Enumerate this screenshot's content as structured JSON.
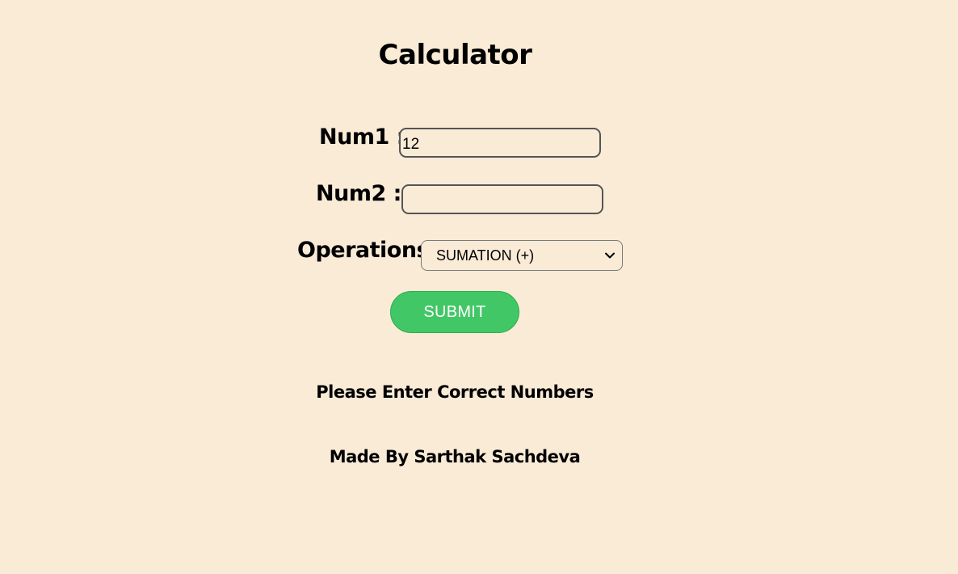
{
  "page": {
    "title": "Calculator"
  },
  "form": {
    "num1": {
      "label": "Num1 :",
      "value": "12",
      "placeholder": ""
    },
    "num2": {
      "label": "Num2 :",
      "value": "",
      "placeholder": ""
    },
    "operations": {
      "label": "Operations",
      "selected": "SUMATION (+)"
    },
    "submit_label": "SUBMIT"
  },
  "result": {
    "message": "Please Enter Correct Numbers"
  },
  "footer": {
    "credit": "Made By Sarthak Sachdeva"
  },
  "colors": {
    "background": "#faebd7",
    "submit_button": "#42c766",
    "text": "#000000"
  },
  "icons": {
    "select_arrow": "chevron-down-icon"
  }
}
